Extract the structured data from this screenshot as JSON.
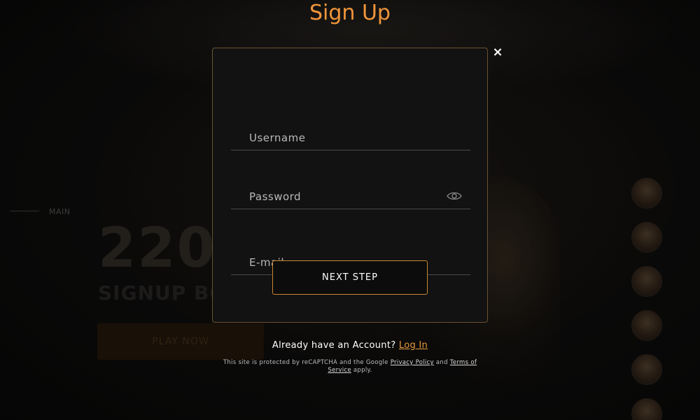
{
  "modal": {
    "title": "Sign Up",
    "close_glyph": "×",
    "fields": {
      "username_placeholder": "Username",
      "password_placeholder": "Password",
      "email_placeholder": "E-mail"
    },
    "next_button_label": "NEXT STEP"
  },
  "login": {
    "prompt": "Already have an Account?",
    "link_label": "Log In"
  },
  "recaptcha": {
    "prefix": "This site is protected by reCAPTCHA and the Google",
    "privacy_label": "Privacy Policy",
    "and": "and",
    "terms_label": "Terms of Service",
    "suffix": "apply."
  },
  "background": {
    "nav_label": "MAIN",
    "big_number": "220",
    "bonus_text": "SIGNUP BO",
    "play_button_label": "PLAY NOW"
  },
  "colors": {
    "accent_orange": "#f0953a",
    "button_border": "#c9862f",
    "card_border": "#6b5330"
  },
  "icons": {
    "close": "close-icon",
    "password_toggle": "eye-icon"
  }
}
